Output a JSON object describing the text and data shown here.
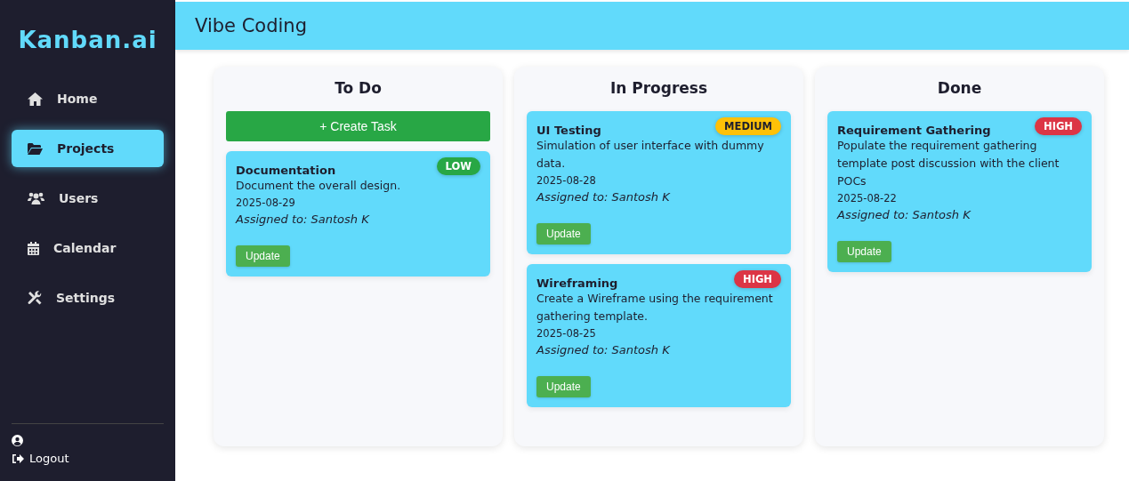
{
  "sidebar": {
    "logo": "Kanban.ai",
    "items": [
      {
        "label": "Home",
        "selected": false
      },
      {
        "label": "Projects",
        "selected": true
      },
      {
        "label": "Users",
        "selected": false
      },
      {
        "label": "Calendar",
        "selected": false
      },
      {
        "label": "Settings",
        "selected": false
      }
    ],
    "logout": "Logout"
  },
  "header": {
    "title": "Vibe Coding"
  },
  "columns": [
    {
      "title": "To Do",
      "create_button": "+ Create Task",
      "cards": [
        {
          "title": "Documentation",
          "badge": {
            "text": "LOW",
            "color": "#28a745"
          },
          "description": "Document the overall design.",
          "date": "2025-08-29",
          "assignee": "Assigned to: Santosh K",
          "button": "Update"
        }
      ]
    },
    {
      "title": "In Progress",
      "cards": [
        {
          "title": "UI Testing",
          "badge": {
            "text": "MEDIUM",
            "color": "#ffc107"
          },
          "description": "Simulation of user interface with dummy data.",
          "date": "2025-08-28",
          "assignee": "Assigned to: Santosh K",
          "button": "Update"
        },
        {
          "title": "Wireframing",
          "badge": {
            "text": "HIGH",
            "color": "#dc3545"
          },
          "description": "Create a Wireframe using the requirement gathering template.",
          "date": "2025-08-25",
          "assignee": "Assigned to: Santosh K",
          "button": "Update"
        }
      ]
    },
    {
      "title": "Done",
      "cards": [
        {
          "title": "Requirement Gathering",
          "badge": {
            "text": "HIGH",
            "color": "#dc3545"
          },
          "description": "Populate the requirement gathering template post discussion with the client POCs",
          "date": "2025-08-22",
          "assignee": "Assigned to: Santosh K",
          "button": "Update"
        }
      ]
    }
  ]
}
